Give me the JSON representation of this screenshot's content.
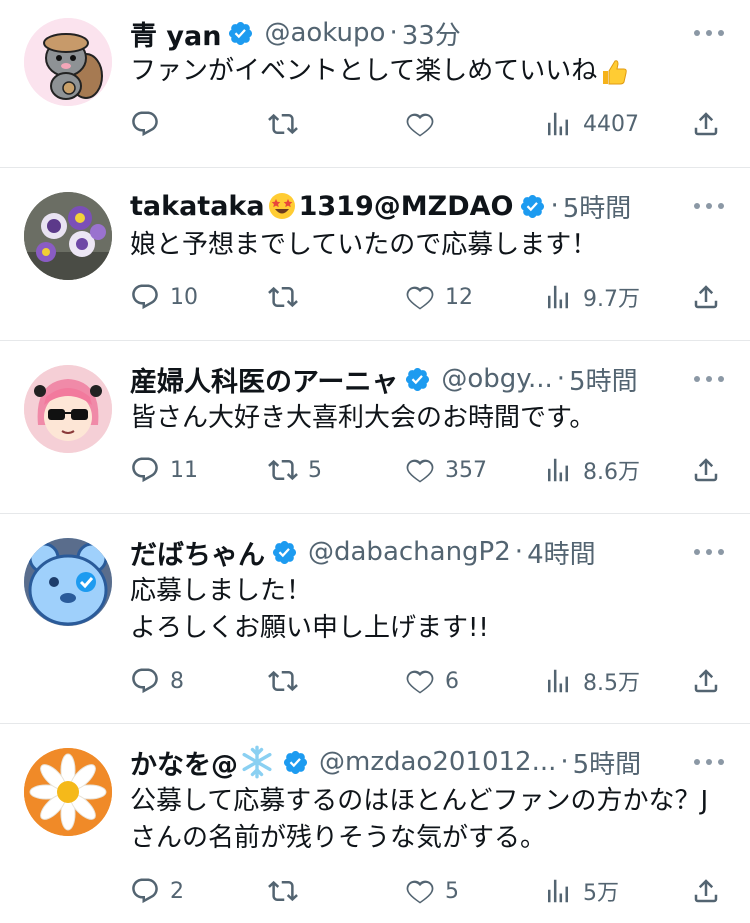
{
  "tweets": [
    {
      "name": "青 yan",
      "handle": "@aokupo",
      "dot": "·",
      "time": "33分",
      "text": "ファンがイベントとして楽しめていいね",
      "text_emoji": "thumbs-up",
      "avatar": "squirrel-avatar",
      "replies": "",
      "retweets": "",
      "likes": "",
      "views": "4407"
    },
    {
      "name": "takataka",
      "name_suffix": "1319@MZDAO",
      "name_emoji": "star-struck-emoji",
      "handle": "",
      "dot": "·",
      "time": "5時間",
      "text": "娘と予想までしていたので応募します！",
      "avatar": "pansy-flowers-avatar",
      "replies": "10",
      "retweets": "",
      "likes": "12",
      "views": "9.7万"
    },
    {
      "name": "産婦人科医のアーニャ",
      "handle": "@obgy...",
      "dot": "·",
      "time": "5時間",
      "text": "皆さん大好き大喜利大会のお時間です。",
      "avatar": "anime-girl-sunglasses-avatar",
      "replies": "11",
      "retweets": "5",
      "likes": "357",
      "views": "8.6万"
    },
    {
      "name": "だばちゃん",
      "handle": "@dabachangP2",
      "dot": "·",
      "time": "4時間",
      "text": "応募しました！\nよろしくお願い申し上げます!!",
      "avatar": "blue-bear-avatar",
      "replies": "8",
      "retweets": "",
      "likes": "6",
      "views": "8.5万"
    },
    {
      "name": "かなを@",
      "name_emoji": "snowflake-emoji",
      "handle": "@mzdao201012...",
      "dot": "·",
      "time": "5時間",
      "text": "公募して応募するのはほとんどファンの方かな？Jさんの名前が残りそうな気がする。",
      "avatar": "daisy-avatar",
      "replies": "2",
      "retweets": "",
      "likes": "5",
      "views": "5万"
    }
  ],
  "colors": {
    "text": "#0f1419",
    "secondary": "#536471",
    "verified": "#1d9bf0",
    "divider": "#e6e8ea"
  },
  "icons": [
    "reply-icon",
    "retweet-icon",
    "like-icon",
    "views-icon",
    "share-icon",
    "more-icon",
    "verified-badge-icon"
  ]
}
